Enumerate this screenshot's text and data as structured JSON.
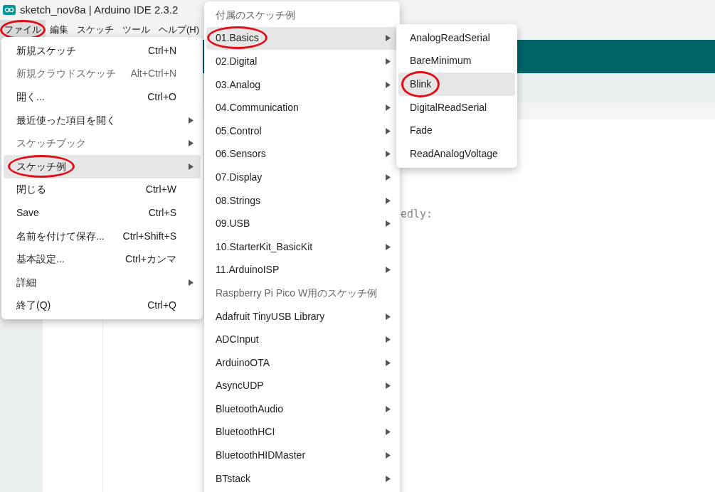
{
  "window": {
    "title": "sketch_nov8a | Arduino IDE 2.3.2"
  },
  "menubar": [
    {
      "label": "ファイル",
      "selected": true,
      "circled": true
    },
    {
      "label": "編集",
      "selected": false,
      "circled": false
    },
    {
      "label": "スケッチ",
      "selected": false,
      "circled": false
    },
    {
      "label": "ツール",
      "selected": false,
      "circled": false
    },
    {
      "label": "ヘルプ(H)",
      "selected": false,
      "circled": false
    }
  ],
  "editor": {
    "code_fragment": "edly:"
  },
  "file_menu": [
    {
      "label": "新規スケッチ",
      "shortcut": "Ctrl+N",
      "submenu": false,
      "disabled": false,
      "selected": false,
      "circled": false
    },
    {
      "label": "新規クラウドスケッチ",
      "shortcut": "Alt+Ctrl+N",
      "submenu": false,
      "disabled": true,
      "selected": false,
      "circled": false
    },
    {
      "label": "開く...",
      "shortcut": "Ctrl+O",
      "submenu": false,
      "disabled": false,
      "selected": false,
      "circled": false
    },
    {
      "label": "最近使った項目を開く",
      "submenu": true,
      "disabled": false,
      "selected": false,
      "circled": false
    },
    {
      "label": "スケッチブック",
      "submenu": true,
      "disabled": true,
      "selected": false,
      "circled": false
    },
    {
      "label": "スケッチ例",
      "submenu": true,
      "disabled": false,
      "selected": true,
      "circled": true
    },
    {
      "label": "閉じる",
      "shortcut": "Ctrl+W",
      "submenu": false,
      "disabled": false,
      "selected": false,
      "circled": false
    },
    {
      "label": "Save",
      "shortcut": "Ctrl+S",
      "submenu": false,
      "disabled": false,
      "selected": false,
      "circled": false
    },
    {
      "label": "名前を付けて保存...",
      "shortcut": "Ctrl+Shift+S",
      "submenu": false,
      "disabled": false,
      "selected": false,
      "circled": false
    },
    {
      "label": "基本設定...",
      "shortcut": "Ctrl+カンマ",
      "submenu": false,
      "disabled": false,
      "selected": false,
      "circled": false
    },
    {
      "label": "詳細",
      "submenu": true,
      "disabled": false,
      "selected": false,
      "circled": false
    },
    {
      "label": "終了(Q)",
      "shortcut": "Ctrl+Q",
      "submenu": false,
      "disabled": false,
      "selected": false,
      "circled": false
    }
  ],
  "examples_menu": [
    {
      "kind": "header",
      "label": "付属のスケッチ例"
    },
    {
      "kind": "item",
      "label": "01.Basics",
      "selected": true,
      "circled": true
    },
    {
      "kind": "item",
      "label": "02.Digital",
      "selected": false,
      "circled": false
    },
    {
      "kind": "item",
      "label": "03.Analog",
      "selected": false,
      "circled": false
    },
    {
      "kind": "item",
      "label": "04.Communication",
      "selected": false,
      "circled": false
    },
    {
      "kind": "item",
      "label": "05.Control",
      "selected": false,
      "circled": false
    },
    {
      "kind": "item",
      "label": "06.Sensors",
      "selected": false,
      "circled": false
    },
    {
      "kind": "item",
      "label": "07.Display",
      "selected": false,
      "circled": false
    },
    {
      "kind": "item",
      "label": "08.Strings",
      "selected": false,
      "circled": false
    },
    {
      "kind": "item",
      "label": "09.USB",
      "selected": false,
      "circled": false
    },
    {
      "kind": "item",
      "label": "10.StarterKit_BasicKit",
      "selected": false,
      "circled": false
    },
    {
      "kind": "item",
      "label": "11.ArduinoISP",
      "selected": false,
      "circled": false
    },
    {
      "kind": "header",
      "label": "Raspberry Pi Pico W用のスケッチ例"
    },
    {
      "kind": "item",
      "label": "Adafruit TinyUSB Library",
      "selected": false,
      "circled": false
    },
    {
      "kind": "item",
      "label": "ADCInput",
      "selected": false,
      "circled": false
    },
    {
      "kind": "item",
      "label": "ArduinoOTA",
      "selected": false,
      "circled": false
    },
    {
      "kind": "item",
      "label": "AsyncUDP",
      "selected": false,
      "circled": false
    },
    {
      "kind": "item",
      "label": "BluetoothAudio",
      "selected": false,
      "circled": false
    },
    {
      "kind": "item",
      "label": "BluetoothHCI",
      "selected": false,
      "circled": false
    },
    {
      "kind": "item",
      "label": "BluetoothHIDMaster",
      "selected": false,
      "circled": false
    },
    {
      "kind": "item",
      "label": "BTstack",
      "selected": false,
      "circled": false
    }
  ],
  "basics_menu": [
    {
      "label": "AnalogReadSerial",
      "selected": false,
      "circled": false
    },
    {
      "label": "BareMinimum",
      "selected": false,
      "circled": false
    },
    {
      "label": "Blink",
      "selected": true,
      "circled": true
    },
    {
      "label": "DigitalReadSerial",
      "selected": false,
      "circled": false
    },
    {
      "label": "Fade",
      "selected": false,
      "circled": false
    },
    {
      "label": "ReadAnalogVoltage",
      "selected": false,
      "circled": false
    }
  ]
}
